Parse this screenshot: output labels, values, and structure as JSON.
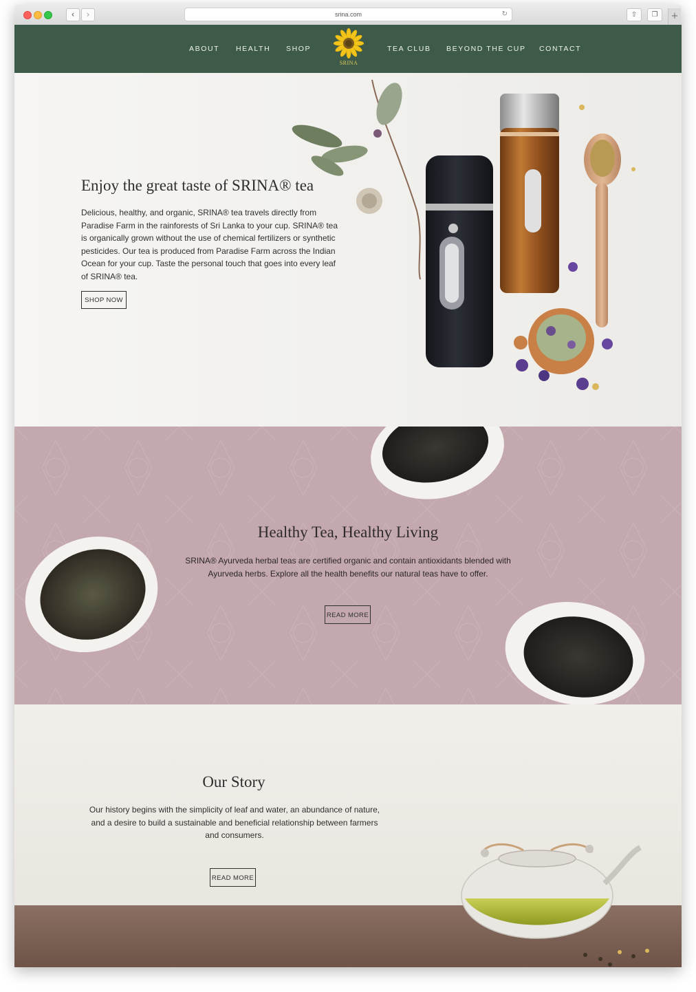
{
  "browser": {
    "url": "srina.com",
    "back_icon": "‹",
    "forward_icon": "›",
    "reload_icon": "↻",
    "share_icon": "⇧",
    "tabs_icon": "❐",
    "newtab_icon": "+"
  },
  "nav": {
    "items": [
      "ABOUT",
      "HEALTH",
      "SHOP",
      "TEA CLUB",
      "BEYOND THE CUP",
      "CONTACT"
    ],
    "logo_text": "SRINA"
  },
  "hero": {
    "title": "Enjoy the great taste of SRINA® tea",
    "body": "Delicious, healthy, and organic, SRINA® tea travels directly from Paradise Farm in the rainforests of Sri Lanka to your cup. SRINA® tea is organically grown without the use of chemical fertilizers or synthetic pesticides. Our tea is produced from Paradise Farm across the Indian Ocean for your cup. Taste the personal touch that goes into every leaf of SRINA® tea.",
    "button": "SHOP NOW"
  },
  "health": {
    "title": "Healthy Tea, Healthy Living",
    "body": "SRINA® Ayurveda herbal teas are certified organic and contain antioxidants blended with Ayurveda herbs. Explore all the health benefits our natural teas have to offer.",
    "button": "READ MORE"
  },
  "story": {
    "title": "Our Story",
    "body": "Our history begins with the simplicity of leaf and water, an abundance of nature, and a desire to build a sustainable and beneficial relationship between farmers and consumers.",
    "button": "READ MORE"
  },
  "colors": {
    "nav_bg": "#3d5b48",
    "health_bg": "#c3a9ae",
    "logo_yellow": "#f2c419",
    "copper": "#b8702e"
  }
}
